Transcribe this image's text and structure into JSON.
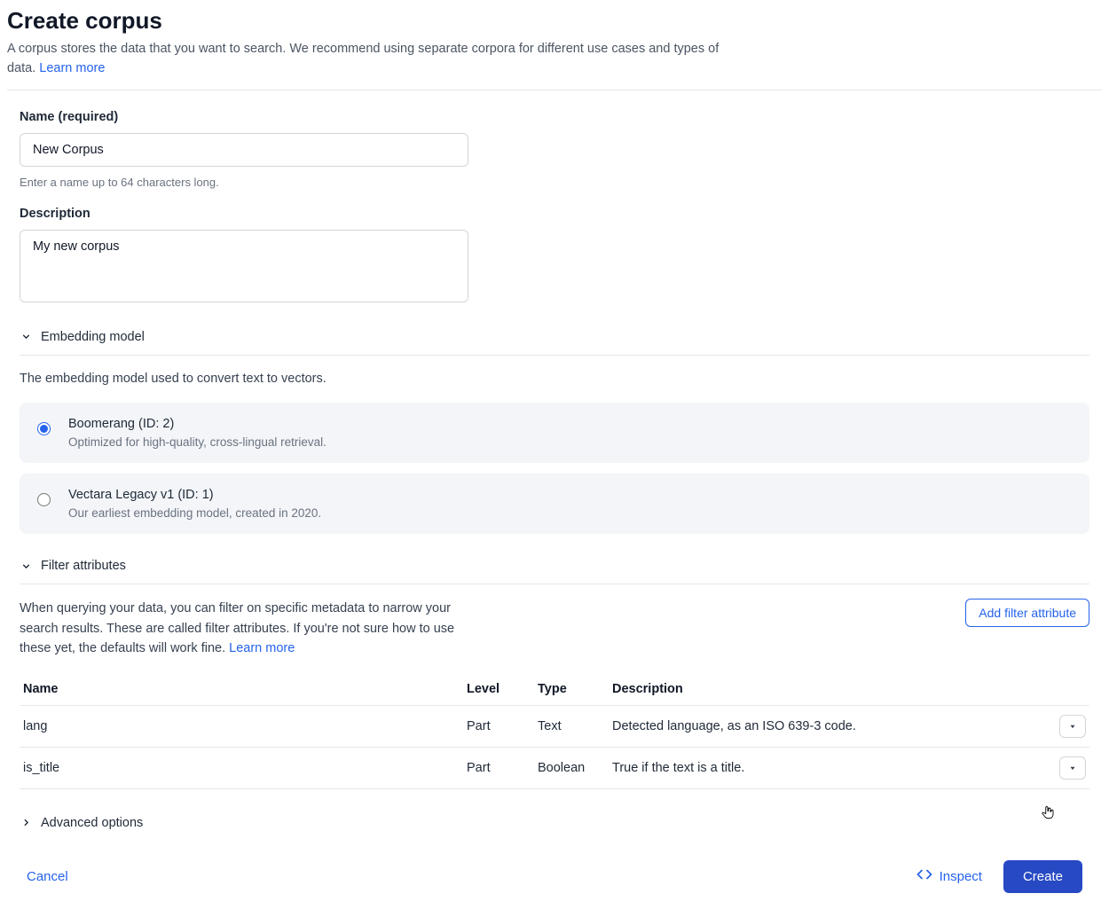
{
  "header": {
    "title": "Create corpus",
    "description": "A corpus stores the data that you want to search. We recommend using separate corpora for different use cases and types of data. ",
    "learn_more": "Learn more"
  },
  "name_field": {
    "label": "Name (required)",
    "value": "New Corpus",
    "helper": "Enter a name up to 64 characters long."
  },
  "description_field": {
    "label": "Description",
    "value": "My new corpus"
  },
  "embedding": {
    "section_title": "Embedding model",
    "description": "The embedding model used to convert text to vectors.",
    "options": [
      {
        "title": "Boomerang (ID: 2)",
        "subtitle": "Optimized for high-quality, cross-lingual retrieval.",
        "selected": true
      },
      {
        "title": "Vectara Legacy v1 (ID: 1)",
        "subtitle": "Our earliest embedding model, created in 2020.",
        "selected": false
      }
    ]
  },
  "filter": {
    "section_title": "Filter attributes",
    "description": "When querying your data, you can filter on specific metadata to narrow your search results. These are called filter attributes. If you're not sure how to use these yet, the defaults will work fine. ",
    "learn_more": "Learn more",
    "add_button": "Add filter attribute",
    "columns": {
      "name": "Name",
      "level": "Level",
      "type": "Type",
      "description": "Description"
    },
    "rows": [
      {
        "name": "lang",
        "level": "Part",
        "type": "Text",
        "description": "Detected language, as an ISO 639-3 code."
      },
      {
        "name": "is_title",
        "level": "Part",
        "type": "Boolean",
        "description": "True if the text is a title."
      }
    ]
  },
  "advanced": {
    "section_title": "Advanced options"
  },
  "footer": {
    "cancel": "Cancel",
    "inspect": "Inspect",
    "create": "Create"
  }
}
